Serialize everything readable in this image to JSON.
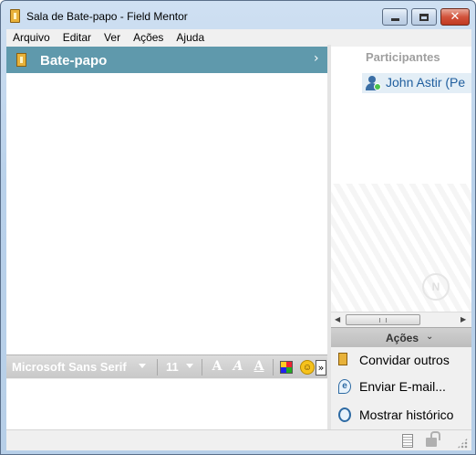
{
  "window": {
    "title": "Sala de Bate-papo - Field Mentor",
    "close_glyph": "✕"
  },
  "menu": {
    "items": [
      "Arquivo",
      "Editar",
      "Ver",
      "Ações",
      "Ajuda"
    ]
  },
  "chat": {
    "header_title": "Bate-papo",
    "header_chevron": "›"
  },
  "format_toolbar": {
    "font_name": "Microsoft Sans Serif",
    "font_size": "11",
    "bold_label": "A",
    "italic_label": "A",
    "underline_label": "A",
    "smiley_glyph": "☺",
    "more_glyph": "»"
  },
  "participants": {
    "title": "Participantes",
    "list": [
      {
        "name": "John Astir (Pe",
        "status_color": "#4ac24a"
      }
    ]
  },
  "scrollbar": {
    "left_arrow": "◀",
    "right_arrow": "▶"
  },
  "actions": {
    "header_label": "Ações",
    "header_chevron": "⌄",
    "items": [
      {
        "label": "Convidar outros",
        "icon": "invite-icon"
      },
      {
        "label": "Enviar E-mail...",
        "icon": "email-icon"
      },
      {
        "label": "Mostrar histórico",
        "icon": "history-icon"
      }
    ]
  },
  "colors": {
    "chat_header": "#5f99ac",
    "participant_name": "#1f5e9e",
    "close_button": "#d2533c"
  }
}
